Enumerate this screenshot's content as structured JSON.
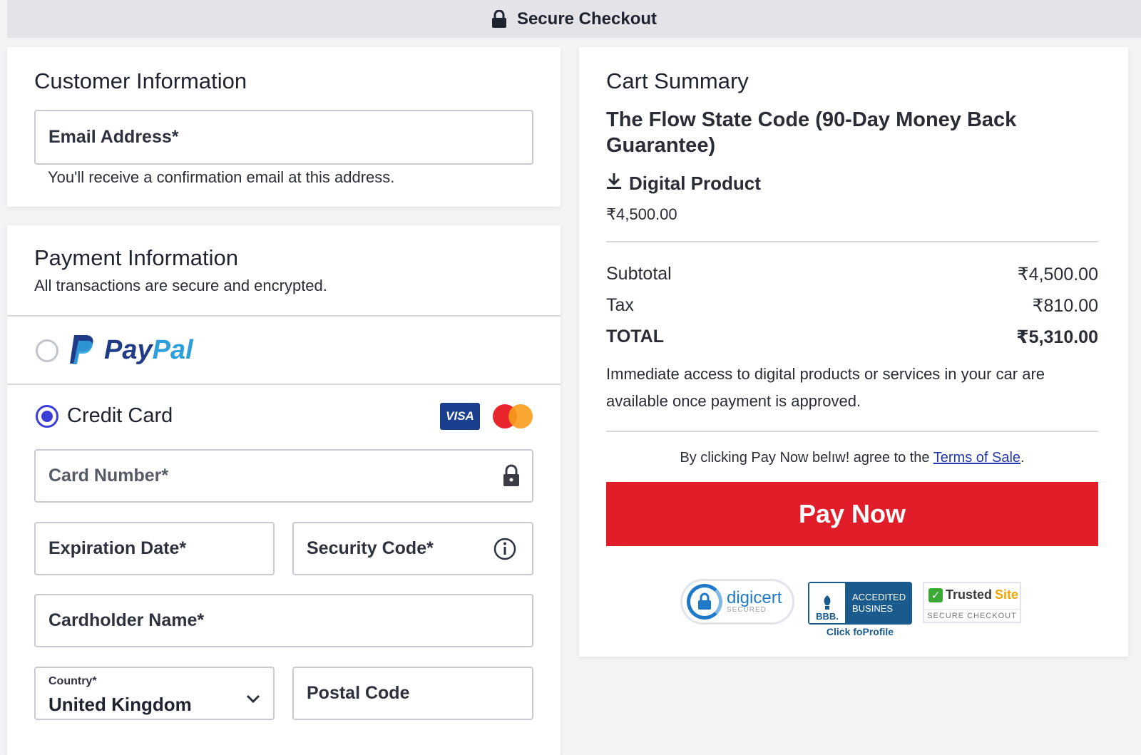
{
  "header": {
    "title": "Secure Checkout",
    "icon": "lock-icon"
  },
  "customer": {
    "heading": "Customer Information",
    "email_label": "Email Address*",
    "email_hint": "You'll receive a confirmation email at this address."
  },
  "payment": {
    "heading": "Payment Information",
    "subheading": "All transactions are secure and encrypted.",
    "paypal": {
      "word1": "Pay",
      "word2": "Pal",
      "selected": false
    },
    "credit_card": {
      "label": "Credit Card",
      "selected": true,
      "visa_label": "VISA",
      "card_number_placeholder": "Card Number*",
      "expiration_placeholder": "Expiration Date*",
      "security_code_placeholder": "Security Code*",
      "cardholder_placeholder": "Cardholder Name*",
      "country_label": "Country*",
      "country_value": "United Kingdom",
      "postal_placeholder": "Postal Code"
    }
  },
  "cart": {
    "heading": "Cart Summary",
    "product_title": "The Flow State Code (90-Day Money Back Guarantee)",
    "product_type": "Digital Product",
    "product_price": "₹4,500.00",
    "subtotal_label": "Subtotal",
    "subtotal_value": "₹4,500.00",
    "tax_label": "Tax",
    "tax_value": "₹810.00",
    "total_label": "TOTAL",
    "total_value": "₹5,310.00",
    "access_note": "Immediate access to digital products or services in your car are available once payment is approved.",
    "terms_prefix": "By clicking Pay Now belıw! agree to the ",
    "terms_link": "Terms of Sale",
    "terms_suffix": ".",
    "pay_button": "Pay Now"
  },
  "badges": {
    "digicert_word": "digicert",
    "digicert_sub": "SECURED",
    "bbb_logo": "BBB.",
    "bbb_line1": "ACCEDITED",
    "bbb_line2": "BUSINES",
    "bbb_link": "Click foProfile",
    "trusted_word1": "Trusted",
    "trusted_word2": "Site",
    "trusted_sub": "SECURE CHECKOUT"
  },
  "colors": {
    "accent": "#3b3fd8",
    "pay_button": "#e21d2a",
    "link": "#2338a8"
  }
}
